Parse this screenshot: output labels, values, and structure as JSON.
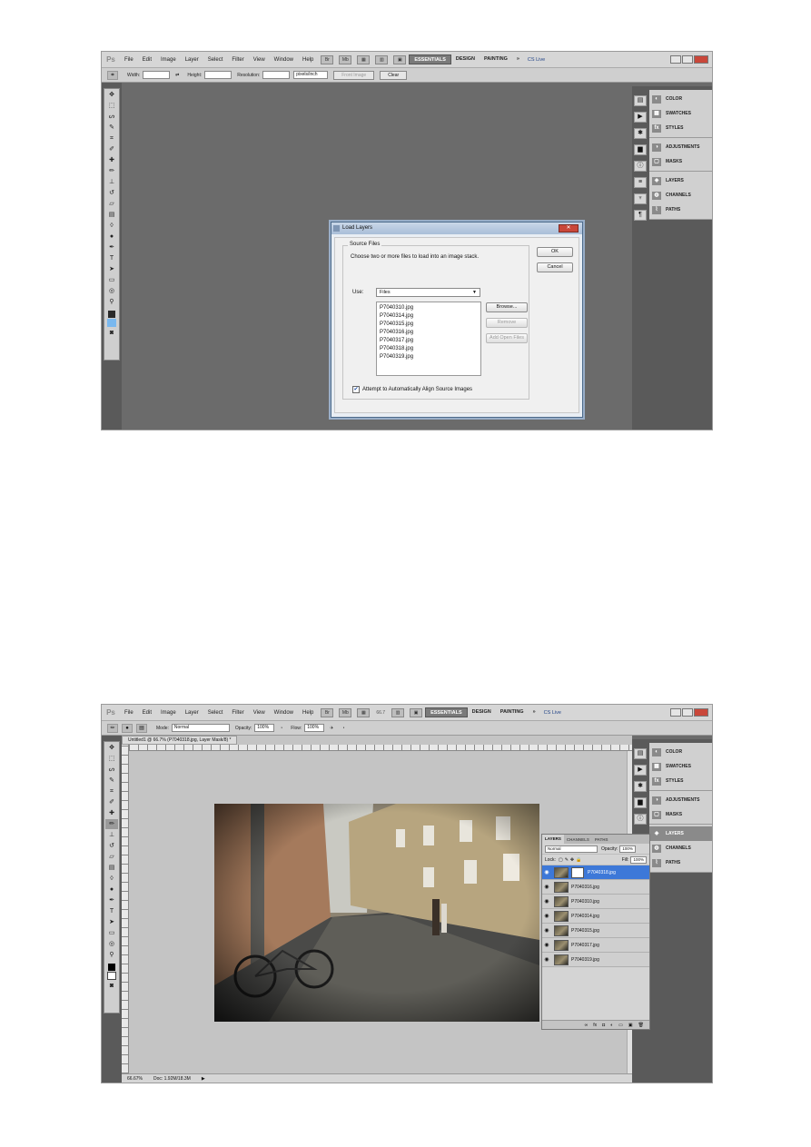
{
  "menu": {
    "logo": "Ps",
    "items": [
      "File",
      "Edit",
      "Image",
      "Layer",
      "Select",
      "Filter",
      "View",
      "Window",
      "Help"
    ],
    "zoom": "66.7",
    "workspaces": [
      "ESSENTIALS",
      "DESIGN",
      "PAINTING"
    ],
    "more": "»",
    "cslive": "CS Live"
  },
  "shot1": {
    "options": {
      "width_label": "Width:",
      "height_label": "Height:",
      "resolution_label": "Resolution:",
      "resolution_unit": "pixels/inch",
      "front_image": "Front Image",
      "clear": "Clear"
    }
  },
  "shot2": {
    "options": {
      "mode_label": "Mode:",
      "mode_value": "Normal",
      "opacity_label": "Opacity:",
      "opacity_value": "100%",
      "flow_label": "Flow:",
      "flow_value": "100%"
    },
    "doc_tab": "Untitled1 @ 66.7% (P7040318.jpg, Layer Mask/8) *",
    "status_zoom": "66.67%",
    "status_doc": "Doc: 1.92M/18.3M"
  },
  "panels": {
    "group1": [
      "COLOR",
      "SWATCHES",
      "STYLES"
    ],
    "group2": [
      "ADJUSTMENTS",
      "MASKS"
    ],
    "group3": [
      "LAYERS",
      "CHANNELS",
      "PATHS"
    ]
  },
  "dialog": {
    "title": "Load Layers",
    "legend": "Source Files",
    "description": "Choose two or more files to load into an image stack.",
    "use_label": "Use:",
    "use_value": "Files",
    "files": [
      "P7040310.jpg",
      "P7040314.jpg",
      "P7040315.jpg",
      "P7040316.jpg",
      "P7040317.jpg",
      "P7040318.jpg",
      "P7040319.jpg"
    ],
    "ok": "OK",
    "cancel": "Cancel",
    "browse": "Browse...",
    "remove": "Remove",
    "add_open": "Add Open Files",
    "checkbox_label": "Attempt to Automatically Align Source Images"
  },
  "layers_panel": {
    "tabs": [
      "LAYERS",
      "CHANNELS",
      "PATHS"
    ],
    "blend": "Normal",
    "opacity_label": "Opacity:",
    "opacity_value": "100%",
    "lock_label": "Lock:",
    "fill_label": "Fill:",
    "fill_value": "100%",
    "layers": [
      "P7040318.jpg",
      "P7040316.jpg",
      "P7040310.jpg",
      "P7040314.jpg",
      "P7040315.jpg",
      "P7040317.jpg",
      "P7040319.jpg"
    ]
  }
}
